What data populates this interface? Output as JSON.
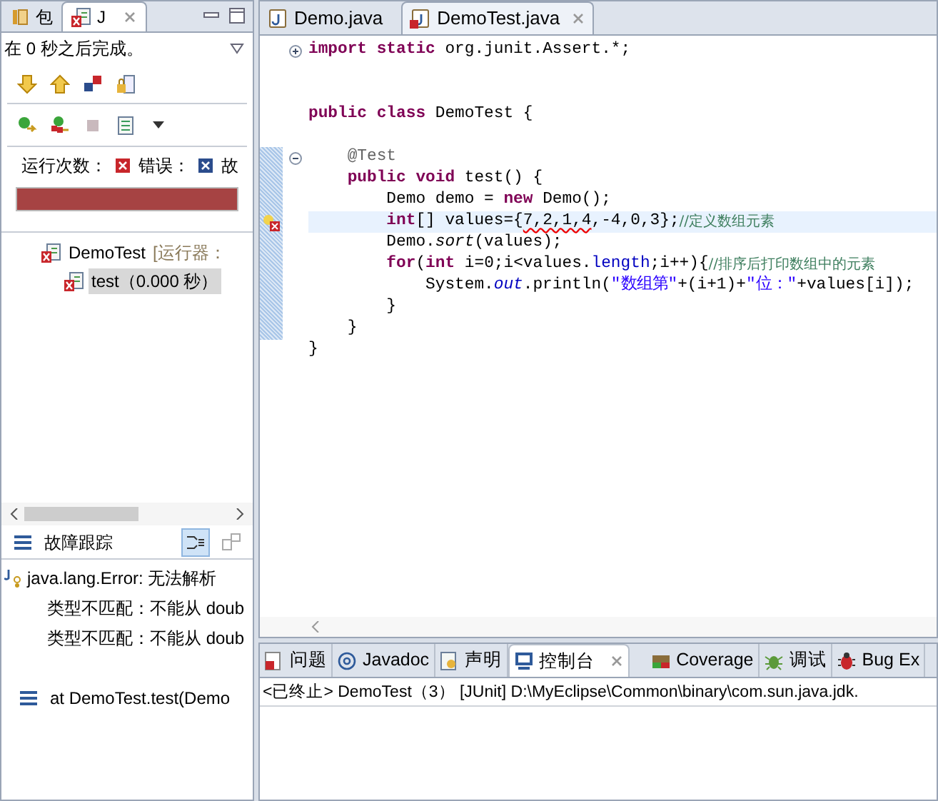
{
  "left_panel": {
    "tabs": [
      {
        "label": "包",
        "selected": false
      },
      {
        "label": "J",
        "selected": true
      }
    ],
    "status": "在 0 秒之后完成。",
    "counters": [
      {
        "label": "运行次数：",
        "kind": "runs"
      },
      {
        "label": "错误：",
        "kind": "errors"
      },
      {
        "label": "故",
        "kind": "failures"
      }
    ],
    "progress": {
      "level": 1
    },
    "tree": [
      {
        "label": "DemoTest",
        "detail": "[运行器：",
        "selected": false,
        "children": [
          {
            "label": "test（0.000 秒）",
            "selected": true
          }
        ]
      }
    ],
    "trace": {
      "title": "故障跟踪",
      "lines": [
        {
          "text": "java.lang.Error: 无法解析",
          "kind": "error"
        },
        {
          "text": "类型不匹配：不能从 doub",
          "kind": "detail"
        },
        {
          "text": "类型不匹配：不能从 doub",
          "kind": "detail"
        },
        {
          "kind": "blank"
        },
        {
          "text": "at DemoTest.test(Demo",
          "kind": "frame"
        }
      ]
    }
  },
  "editor": {
    "tabs": [
      {
        "label": "Demo.java",
        "selected": false,
        "error": false
      },
      {
        "label": "DemoTest.java",
        "selected": true,
        "error": true
      }
    ],
    "lines": [
      {
        "current": false,
        "error": false,
        "folded": true,
        "segments": [
          {
            "text": "import static",
            "kind": "keyword"
          },
          {
            "text": " org.junit.Assert.*;",
            "kind": "plain"
          }
        ]
      },
      {
        "current": false,
        "error": false
      },
      {
        "current": false,
        "error": false
      },
      {
        "current": false,
        "error": false,
        "segments": [
          {
            "text": "public class",
            "kind": "keyword"
          },
          {
            "text": " DemoTest {",
            "kind": "plain"
          }
        ]
      },
      {
        "current": false,
        "error": false
      },
      {
        "current": false,
        "error": false,
        "folded": false,
        "segments": [
          {
            "text": "    @Test",
            "kind": "annotation"
          }
        ]
      },
      {
        "current": false,
        "error": false,
        "segments": [
          {
            "text": "    public void",
            "kind": "keyword"
          },
          {
            "text": " test() {",
            "kind": "plain"
          }
        ]
      },
      {
        "current": false,
        "error": false,
        "segments": [
          {
            "text": "        Demo demo = ",
            "kind": "plain"
          },
          {
            "text": "new",
            "kind": "keyword"
          },
          {
            "text": " Demo();",
            "kind": "plain"
          }
        ]
      },
      {
        "current": true,
        "error": true,
        "segments": [
          {
            "text": "        int",
            "kind": "keyword"
          },
          {
            "text": "[] values={",
            "kind": "plain"
          },
          {
            "text": "7,2,1,4",
            "kind": "squiggle"
          },
          {
            "text": ",-4,0,3};",
            "kind": "plain"
          },
          {
            "text": "//定义数组元素",
            "kind": "comment"
          }
        ]
      },
      {
        "current": false,
        "error": false,
        "segments": [
          {
            "text": "        Demo.",
            "kind": "plain"
          },
          {
            "text": "sort",
            "kind": "italic"
          },
          {
            "text": "(values);",
            "kind": "plain"
          }
        ]
      },
      {
        "current": false,
        "error": false,
        "segments": [
          {
            "text": "        for",
            "kind": "keyword"
          },
          {
            "text": "(",
            "kind": "plain"
          },
          {
            "text": "int",
            "kind": "keyword"
          },
          {
            "text": " i=0;i<values.",
            "kind": "plain"
          },
          {
            "text": "length",
            "kind": "field"
          },
          {
            "text": ";i++){",
            "kind": "plain"
          },
          {
            "text": "//排序后打印数组中的元素",
            "kind": "comment"
          }
        ]
      },
      {
        "current": false,
        "error": false,
        "segments": [
          {
            "text": "            System.",
            "kind": "plain"
          },
          {
            "text": "out",
            "kind": "static"
          },
          {
            "text": ".println(",
            "kind": "plain"
          },
          {
            "text": "\"数组第\"",
            "kind": "string"
          },
          {
            "text": "+(i+1)+",
            "kind": "plain"
          },
          {
            "text": "\"位：\"",
            "kind": "string"
          },
          {
            "text": "+values[i]);",
            "kind": "plain"
          }
        ]
      },
      {
        "current": false,
        "error": false,
        "segments": [
          {
            "text": "        }",
            "kind": "plain"
          }
        ]
      },
      {
        "current": false,
        "error": false,
        "segments": [
          {
            "text": "    }",
            "kind": "plain"
          }
        ]
      },
      {
        "current": false,
        "error": false,
        "segments": [
          {
            "text": "}",
            "kind": "plain"
          }
        ]
      }
    ]
  },
  "bottom_panel": {
    "tabs": [
      {
        "label": "问题",
        "kind": "problems",
        "selected": false
      },
      {
        "label": "Javadoc",
        "kind": "javadoc",
        "selected": false
      },
      {
        "label": "声明",
        "kind": "declaration",
        "selected": false
      },
      {
        "label": "控制台",
        "kind": "console",
        "selected": true
      },
      {
        "label": "Coverage",
        "kind": "coverage",
        "selected": false
      },
      {
        "label": "调试",
        "kind": "debug",
        "selected": false
      },
      {
        "label": "Bug Ex",
        "kind": "bug",
        "selected": false
      }
    ],
    "console_header": "<已终止> DemoTest（3） [JUnit] D:\\MyEclipse\\Common\\binary\\com.sun.java.jdk."
  }
}
